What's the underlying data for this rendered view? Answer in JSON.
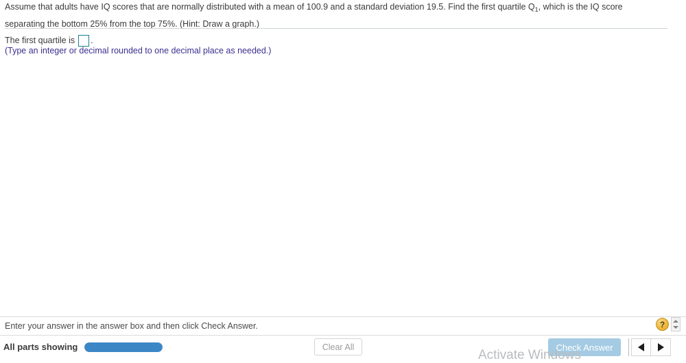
{
  "question": {
    "text_before_sub": "Assume that adults have IQ scores that are normally distributed with a mean of 100.9 and a standard deviation 19.5. Find the first quartile Q",
    "subscript": "1",
    "text_after_sub": ", which is the IQ score separating the bottom 25% from the top 75%. (Hint: Draw a graph.)",
    "mean": "100.9",
    "standard_deviation": "19.5",
    "quartile_label": "Q1",
    "bottom_percent": "25%",
    "top_percent": "75%"
  },
  "answer": {
    "prompt": "The first quartile is",
    "period": ".",
    "input_value": "",
    "input_placeholder": "",
    "hint": "(Type an integer or decimal rounded to one decimal place as needed.)"
  },
  "status": {
    "message": "Enter your answer in the answer box and then click Check Answer."
  },
  "help": {
    "icon": "question-mark-icon",
    "label": "?"
  },
  "spinner": {
    "up_icon": "triangle-up-icon",
    "down_icon": "triangle-down-icon"
  },
  "toolbar": {
    "parts_label": "All parts showing",
    "progress_percent": 100,
    "clear_all_label": "Clear All",
    "check_answer_label": "Check Answer",
    "prev_icon": "arrow-left-icon",
    "next_icon": "arrow-right-icon"
  },
  "watermark": {
    "text": "Activate Windows"
  },
  "colors": {
    "accent_blue": "#3c86c6",
    "check_button": "#a4cbe3",
    "input_border": "#17808f",
    "hint_text": "#3b2f8f",
    "help_gold": "#eebb3e"
  }
}
